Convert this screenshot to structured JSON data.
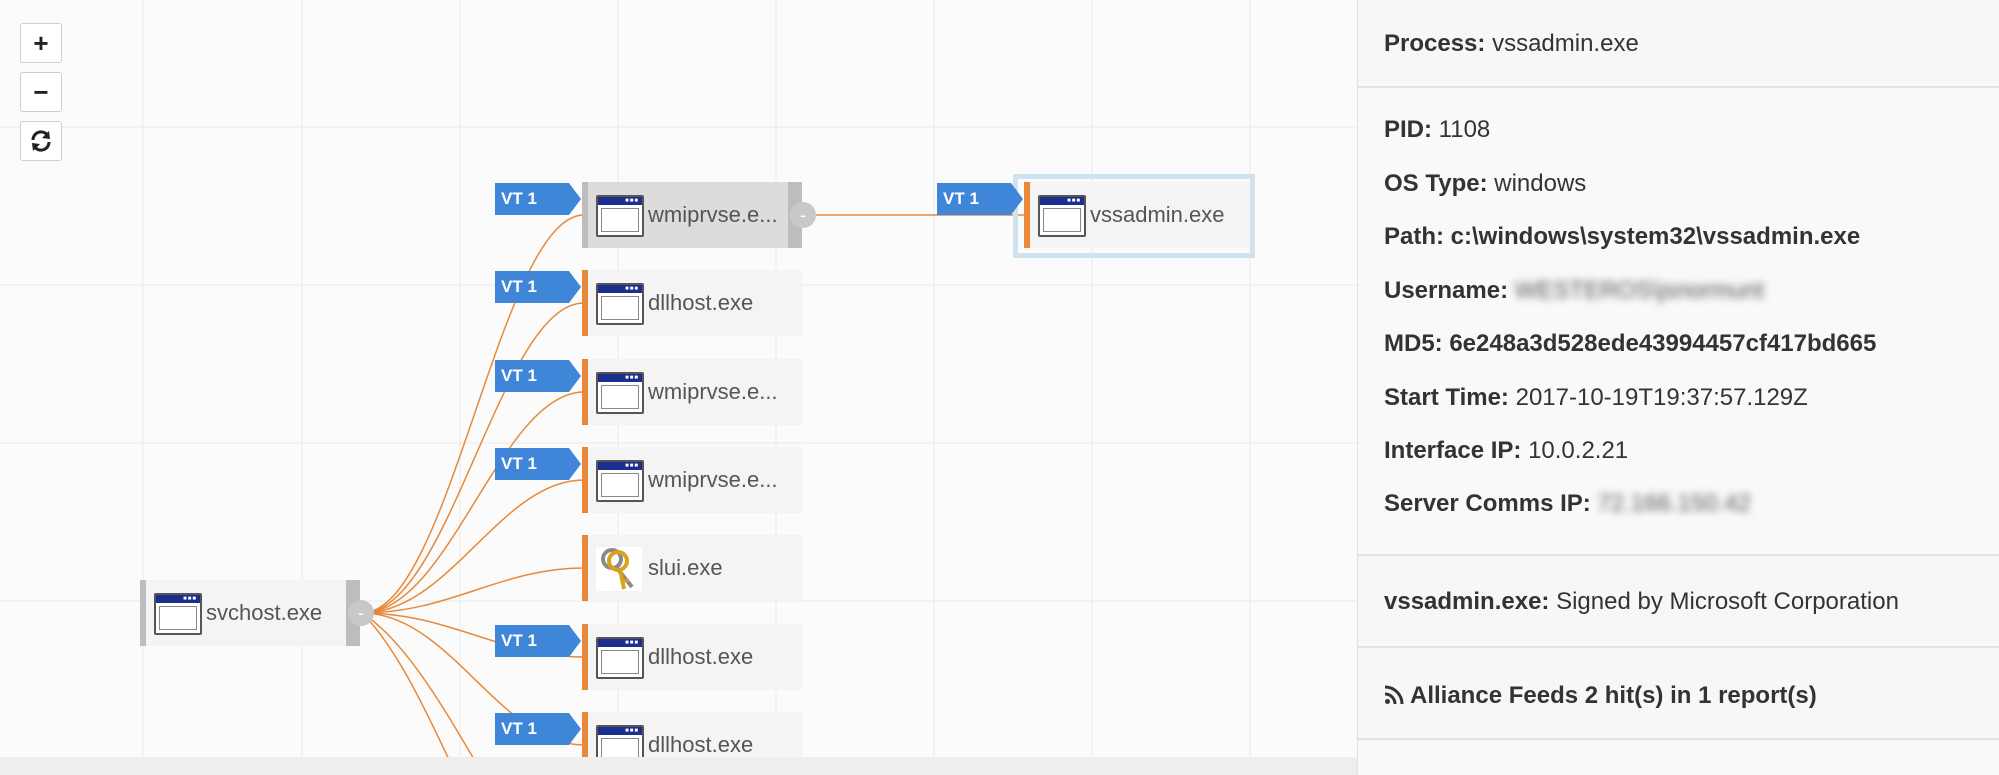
{
  "zoom": {
    "in_label": "+",
    "out_label": "−",
    "reset_icon": "refresh-icon"
  },
  "badge_label": "VT 1",
  "graph": {
    "root": {
      "label": "svchost.exe",
      "collapse": "-"
    },
    "children": [
      {
        "label": "wmiprvse.e...",
        "collapse": "-"
      },
      {
        "label": "dllhost.exe"
      },
      {
        "label": "wmiprvse.e..."
      },
      {
        "label": "wmiprvse.e..."
      },
      {
        "label": "slui.exe"
      },
      {
        "label": "dllhost.exe"
      },
      {
        "label": "dllhost.exe"
      }
    ],
    "grandchild": {
      "label": "vssadmin.exe"
    }
  },
  "panel": {
    "header": {
      "key": "Process:",
      "value": "vssadmin.exe"
    },
    "details": [
      {
        "key": "PID:",
        "value": "1108"
      },
      {
        "key": "OS Type:",
        "value": "windows"
      },
      {
        "key": "Path: c:\\windows\\system32\\vssadmin.exe",
        "value": ""
      },
      {
        "key": "Username:",
        "value": "WESTEROS\\jsnormunt"
      },
      {
        "key": "MD5: 6e248a3d528ede43994457cf417bd665",
        "value": ""
      },
      {
        "key": "Start Time:",
        "value": "2017-10-19T19:37:57.129Z"
      },
      {
        "key": "Interface IP:",
        "value": "10.0.2.21"
      },
      {
        "key": "Server Comms IP:",
        "value": "72.166.150.42"
      }
    ],
    "signature": {
      "key": "vssadmin.exe:",
      "value": "Signed by Microsoft Corporation"
    },
    "feeds": {
      "label": "Alliance Feeds 2 hit(s) in 1 report(s)"
    }
  },
  "colors": {
    "edge": "#e8893a",
    "badge": "#3f86d8",
    "selected_ring": "#cfe2ee"
  }
}
